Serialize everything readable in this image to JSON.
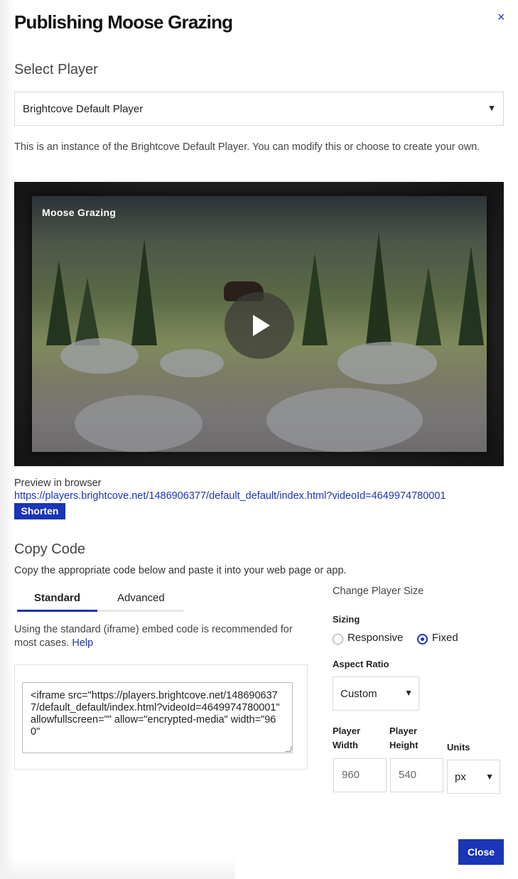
{
  "dialog": {
    "title": "Publishing Moose Grazing",
    "close_icon": "×"
  },
  "select_player": {
    "heading": "Select Player",
    "selected": "Brightcove Default Player",
    "arrow": "▼",
    "description": "This is an instance of the Brightcove Default Player. You can modify this or choose to create your own."
  },
  "player_preview": {
    "video_title": "Moose Grazing"
  },
  "preview": {
    "label": "Preview in browser",
    "url": "https://players.brightcove.net/1486906377/default_default/index.html?videoId=4649974780001",
    "shorten_label": "Shorten"
  },
  "copy_code": {
    "heading": "Copy Code",
    "description": "Copy the appropriate code below and paste it into your web page or app.",
    "tabs": [
      {
        "label": "Standard",
        "active": true
      },
      {
        "label": "Advanced",
        "active": false
      }
    ],
    "note_text": "Using the standard (iframe) embed code is recommended for most cases.",
    "help_link": "Help",
    "code": "<iframe src=\"https://players.brightcove.net/1486906377/default_default/index.html?videoId=4649974780001\" allowfullscreen=\"\" allow=\"encrypted-media\" width=\"960\""
  },
  "player_size": {
    "heading": "Change Player Size",
    "sizing_label": "Sizing",
    "sizing_options": [
      {
        "label": "Responsive",
        "selected": false
      },
      {
        "label": "Fixed",
        "selected": true
      }
    ],
    "aspect_label": "Aspect Ratio",
    "aspect_value": "Custom",
    "width_label": "Player Width",
    "height_label": "Player Height",
    "units_label": "Units",
    "width_value": "960",
    "height_value": "540",
    "units_value": "px"
  },
  "footer": {
    "close_label": "Close"
  },
  "colors": {
    "accent": "#1a35b6"
  }
}
